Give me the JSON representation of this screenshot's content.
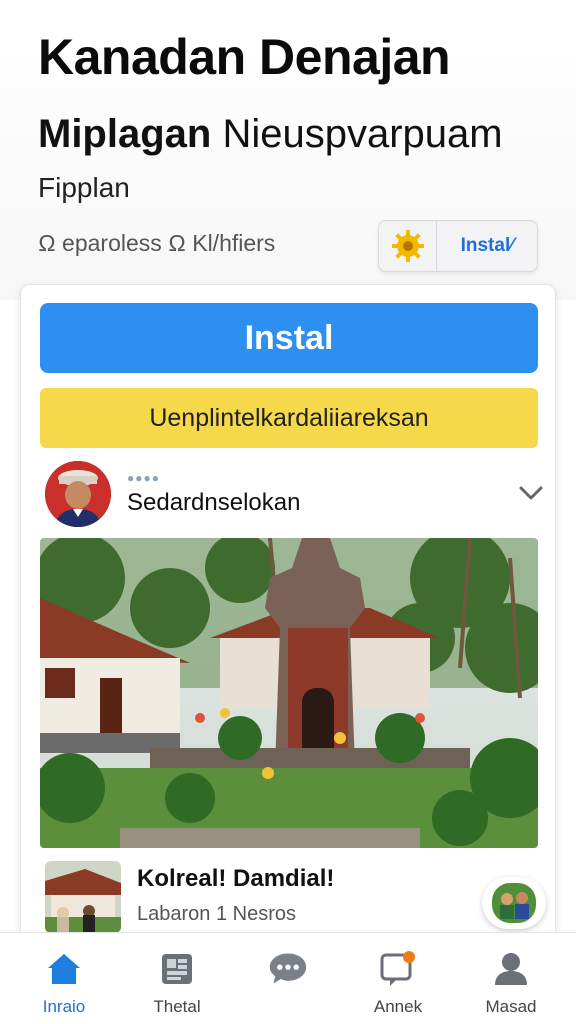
{
  "header": {
    "title": "Kanadan Denajan",
    "subtitle_bold": "Miplagan",
    "subtitle_rest": "Nieuspvarpuam",
    "section_label": "Fipplan",
    "meta": "Ω eparoless Ω Kl/hfiers",
    "top_install_label": "Instal⁄",
    "colors": {
      "accent": "#1f6fd6",
      "gear": "#f2b900"
    }
  },
  "card": {
    "install_label": "Instal",
    "promo_label": "Uenplintelkardaliiareksan",
    "colors": {
      "install_bg": "#2d8ff0",
      "promo_bg": "#f6d94a"
    },
    "post": {
      "dots": "●●●●",
      "author": "Sedardnselokan",
      "menu_icon": "chevron-down-icon"
    },
    "related": {
      "title": "Kolreal! Damdial!",
      "subtitle": "Labaron 1 Nesros"
    }
  },
  "tabbar": {
    "items": [
      {
        "label": "Inraio",
        "icon": "home-icon",
        "active": true
      },
      {
        "label": "Thetal",
        "icon": "grid-icon",
        "active": false
      },
      {
        "label": "",
        "icon": "chat-icon",
        "active": false
      },
      {
        "label": "Annek",
        "icon": "notification-icon",
        "active": false
      },
      {
        "label": "Masad",
        "icon": "profile-icon",
        "active": false
      }
    ]
  }
}
